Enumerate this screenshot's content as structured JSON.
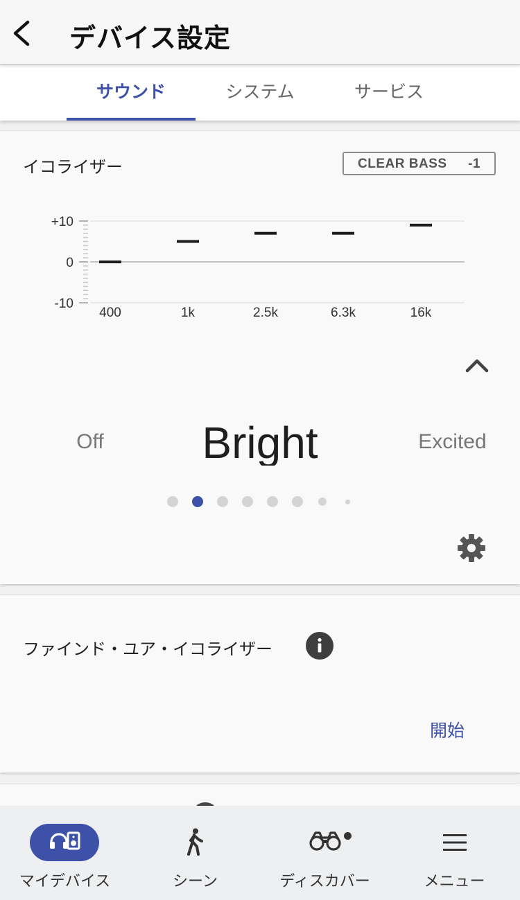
{
  "header": {
    "title": "デバイス設定",
    "back_icon": "chevron-left-icon"
  },
  "tabs": [
    {
      "label": "サウンド",
      "active": true
    },
    {
      "label": "システム",
      "active": false
    },
    {
      "label": "サービス",
      "active": false
    }
  ],
  "equalizer": {
    "title": "イコライザー",
    "clear_bass": {
      "label": "CLEAR BASS",
      "value": "-1"
    },
    "chart_data": {
      "type": "bar",
      "categories": [
        "400",
        "1k",
        "2.5k",
        "6.3k",
        "16k"
      ],
      "values": [
        0,
        5,
        7,
        7,
        9
      ],
      "ylim": [
        -10,
        10
      ],
      "yticks": [
        "+10",
        "0",
        "-10"
      ]
    },
    "presets": {
      "previous": "Off",
      "current": "Bright",
      "next": "Excited"
    },
    "page_count": 8,
    "active_page": 1,
    "collapse_icon": "chevron-up-icon",
    "settings_icon": "gear-icon"
  },
  "find_your_equalizer": {
    "title": "ファインド・ユア・イコライザー",
    "info_icon": "info-icon",
    "start_label": "開始"
  },
  "bottom_nav": [
    {
      "label": "マイデバイス",
      "icon": "headphones-speaker-icon",
      "active": true
    },
    {
      "label": "シーン",
      "icon": "walking-person-icon",
      "active": false
    },
    {
      "label": "ディスカバー",
      "icon": "binoculars-icon",
      "active": false,
      "badge": true
    },
    {
      "label": "メニュー",
      "icon": "hamburger-menu-icon",
      "active": false
    }
  ],
  "colors": {
    "accent": "#3d51a8",
    "inactive_dot": "#d4d4d4"
  }
}
